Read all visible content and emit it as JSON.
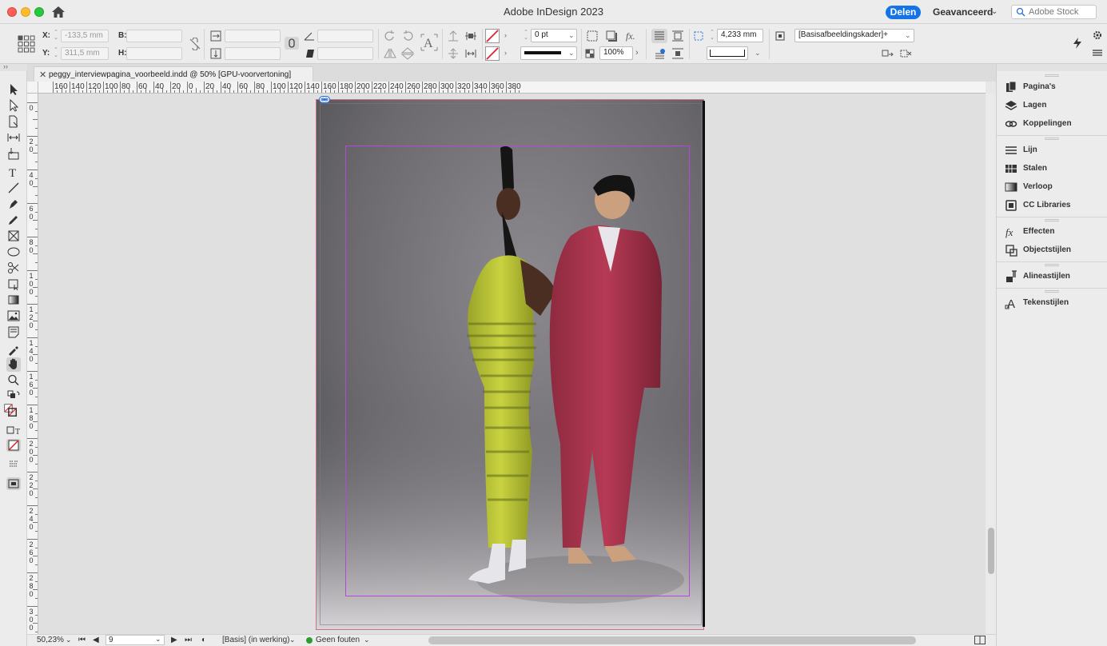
{
  "app": {
    "title": "Adobe InDesign 2023",
    "share_label": "Delen",
    "workspace_label": "Geavanceerd",
    "stock_placeholder": "Adobe Stock"
  },
  "control": {
    "x_label": "X:",
    "x_value": "-133,5 mm",
    "y_label": "Y:",
    "y_value": "311,5 mm",
    "w_label": "B:",
    "h_label": "H:",
    "stroke_weight": "0 pt",
    "opacity": "100%",
    "offset": "4,233 mm",
    "object_style": "[Basisafbeeldingskader]+"
  },
  "document": {
    "tab_title": "peggy_interviewpagina_voorbeeld.indd @ 50% [GPU-voorvertoning]",
    "close_glyph": "✕"
  },
  "rulers": {
    "horizontal": [
      "160",
      "140",
      "120",
      "100",
      "80",
      "60",
      "40",
      "20",
      "0",
      "20",
      "40",
      "60",
      "80",
      "100",
      "120",
      "140",
      "160",
      "180",
      "200",
      "220",
      "240",
      "260",
      "280",
      "300",
      "320",
      "340",
      "360",
      "380"
    ],
    "vertical": [
      "0",
      "20",
      "40",
      "60",
      "80",
      "100",
      "120",
      "140",
      "160",
      "180",
      "200",
      "220",
      "240",
      "260",
      "280",
      "300"
    ]
  },
  "status": {
    "zoom": "50,23%",
    "page_number": "9",
    "master": "[Basis] (in werking)",
    "preflight": "Geen fouten",
    "preflight_color": "#2d9d2d"
  },
  "dock": {
    "groups": [
      [
        {
          "label": "Pagina's",
          "icon": "pages-icon"
        },
        {
          "label": "Lagen",
          "icon": "layers-icon"
        },
        {
          "label": "Koppelingen",
          "icon": "links-icon"
        }
      ],
      [
        {
          "label": "Lijn",
          "icon": "stroke-icon"
        },
        {
          "label": "Stalen",
          "icon": "swatches-icon"
        },
        {
          "label": "Verloop",
          "icon": "gradient-icon"
        },
        {
          "label": "CC Libraries",
          "icon": "cc-libraries-icon"
        }
      ],
      [
        {
          "label": "Effecten",
          "icon": "effects-icon"
        },
        {
          "label": "Objectstijlen",
          "icon": "object-styles-icon"
        }
      ],
      [
        {
          "label": "Alineastijlen",
          "icon": "paragraph-styles-icon"
        }
      ],
      [
        {
          "label": "Tekenstijlen",
          "icon": "character-styles-icon"
        }
      ]
    ]
  },
  "colors": {
    "accent": "#1473e6",
    "margin_guide": "#b44ad4",
    "page_border": "#d06d8d"
  }
}
